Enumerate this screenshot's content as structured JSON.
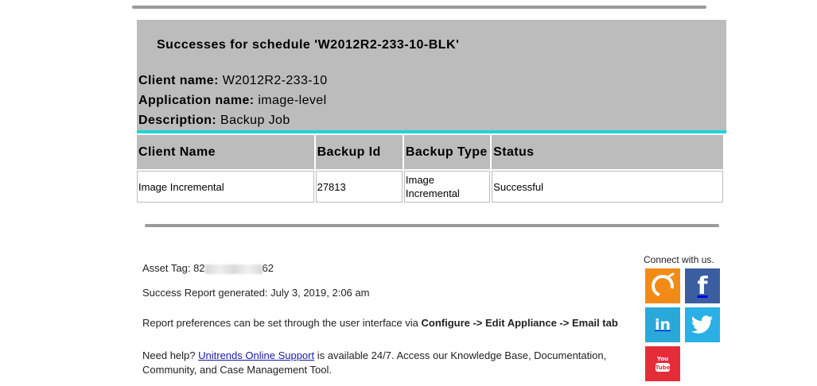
{
  "header": {
    "schedule_title": "Successes for schedule 'W2012R2-233-10-BLK'",
    "client_label": "Client name:",
    "client_value": "W2012R2-233-10",
    "app_label": "Application name:",
    "app_value": "image-level",
    "desc_label": "Description:",
    "desc_value": "Backup Job"
  },
  "table": {
    "columns": [
      "Client Name",
      "Backup Id",
      "Backup Type",
      "Status"
    ],
    "rows": [
      [
        "Image Incremental",
        "27813",
        "Image Incremental",
        "Successful"
      ]
    ]
  },
  "footer": {
    "asset_label": "Asset Tag: 82",
    "asset_suffix": "62",
    "generated": "Success Report generated: July 3, 2019, 2:06 am",
    "prefs_text": "Report preferences can be set through the user interface via ",
    "prefs_path": "Configure -> Edit Appliance -> Email tab",
    "help_prefix": "Need help? ",
    "help_link": "Unitrends Online Support",
    "help_suffix": " is available 24/7. Access our Knowledge Base, Documentation, Community, and Case Management Tool."
  },
  "social": {
    "connect_label": "Connect with us.",
    "icons": [
      "unitrends-icon",
      "facebook-icon",
      "linkedin-icon",
      "twitter-icon",
      "youtube-icon"
    ],
    "facebook_glyph": "f",
    "linkedin_glyph": "in",
    "youtube_glyph": "You Tube"
  },
  "colors": {
    "header_bg": "#bcbcbc",
    "accent_rule": "#22d3d3",
    "link": "#1a1aa6"
  }
}
